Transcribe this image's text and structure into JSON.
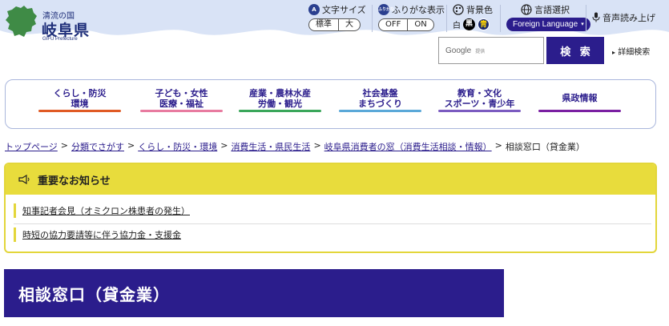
{
  "logo": {
    "sub": "清流の国",
    "name": "岐阜県",
    "en": "GIFU Prefecture",
    "map_color": "#3f8b46"
  },
  "tools": {
    "font_size": {
      "label": "文字サイズ",
      "options": [
        "標準",
        "大"
      ]
    },
    "furigana": {
      "label": "ふりがな表示",
      "icon_text": "ふりがな",
      "options": [
        "OFF",
        "ON"
      ]
    },
    "bg_color": {
      "label": "背景色",
      "options": [
        "白",
        "黒",
        "青"
      ]
    },
    "language": {
      "label": "言語選択",
      "button": "Foreign Language"
    },
    "voice": {
      "label": "音声読み上げ"
    }
  },
  "search": {
    "brand": "Google",
    "hint": "提供",
    "button": "検 索",
    "advanced": "詳細検索"
  },
  "gnav": [
    {
      "label": "くらし・防災\n環境",
      "color": "#e05a24"
    },
    {
      "label": "子ども・女性\n医療・福祉",
      "color": "#e87ba0"
    },
    {
      "label": "産業・農林水産\n労働・観光",
      "color": "#3aa65a"
    },
    {
      "label": "社会基盤\nまちづくり",
      "color": "#5aa8d8"
    },
    {
      "label": "教育・文化\nスポーツ・青少年",
      "color": "#7b5bc0"
    },
    {
      "label": "県政情報",
      "color": "#7a1fa2"
    }
  ],
  "breadcrumb": {
    "links": [
      "トップページ",
      "分類でさがす",
      "くらし・防災・環境",
      "消費生活・県民生活",
      "岐阜県消費者の窓（消費生活相談・情報）"
    ],
    "separator": ">",
    "current": "相談窓口（貸金業）"
  },
  "notice": {
    "title": "重要なお知らせ",
    "items": [
      "知事記者会見（オミクロン株患者の発生）",
      "時短の協力要請等に伴う協力金・支援金"
    ]
  },
  "page_title": "相談窓口（貸金業）",
  "colors": {
    "header_bg": "#d9e3f6",
    "brand": "#2b1d8c",
    "notice": "#e8dc3c"
  }
}
